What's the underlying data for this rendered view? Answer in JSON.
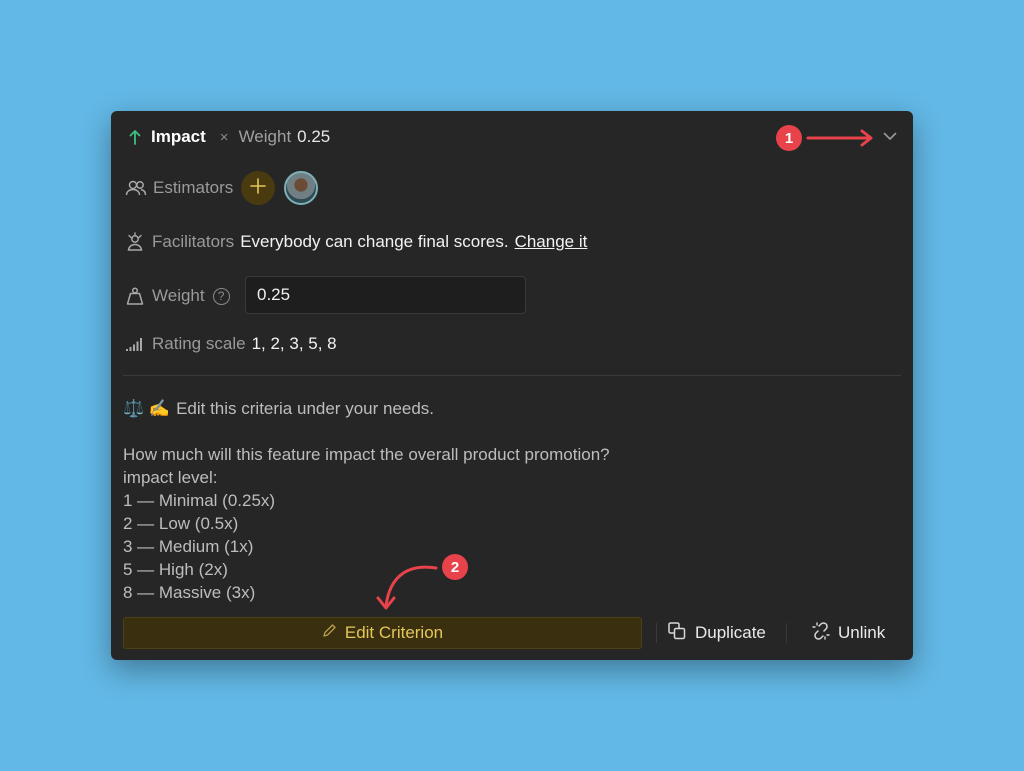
{
  "colors": {
    "background": "#62b8e6",
    "card": "#262626",
    "accent_gold": "#e4c75a",
    "arrow_green": "#3fbf7f",
    "annotation_red": "#e8424a"
  },
  "header": {
    "direction_icon": "arrow-up-icon",
    "title": "Impact",
    "times": "×",
    "weight_label": "Weight",
    "weight_value": "0.25",
    "collapse_icon": "chevron-down-icon"
  },
  "estimators": {
    "icon": "users-icon",
    "label": "Estimators",
    "add_icon": "plus-icon",
    "avatar": "user-avatar"
  },
  "facilitators": {
    "icon": "facilitator-icon",
    "label": "Facilitators",
    "text": "Everybody can change final scores.",
    "link": "Change it"
  },
  "weight": {
    "icon": "weight-icon",
    "label": "Weight",
    "help_icon": "question-icon",
    "help_glyph": "?",
    "input_value": "0.25"
  },
  "rating": {
    "icon": "signal-bars-icon",
    "label": "Rating scale",
    "values": "1, 2, 3, 5, 8"
  },
  "note": {
    "icons": "⚖️ ✍️",
    "text": "Edit this criteria under your needs."
  },
  "description": {
    "lines": [
      "How much will this feature impact the overall product promotion?",
      "impact level:",
      "1 — Minimal (0.25x)",
      "2 — Low (0.5x)",
      "3 — Medium (1x)",
      "5 — High (2x)",
      "8 — Massive (3x)"
    ]
  },
  "footer": {
    "edit_label": "Edit Criterion",
    "duplicate_label": "Duplicate",
    "unlink_label": "Unlink"
  },
  "annotations": {
    "badge1": "1",
    "badge2": "2"
  }
}
